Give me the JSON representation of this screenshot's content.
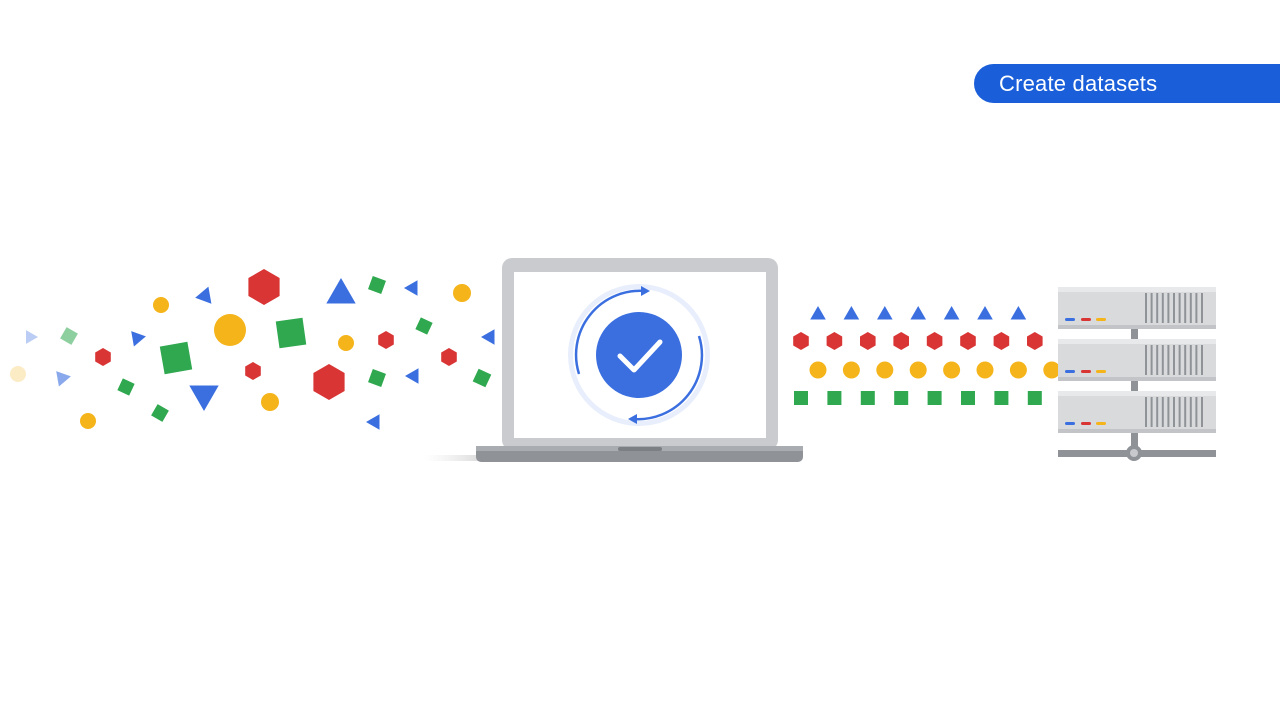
{
  "header": {
    "title": "Create datasets"
  },
  "colors": {
    "blue": "#3b6fe0",
    "red": "#d93535",
    "yellow": "#f4b41a",
    "green": "#2fa84f",
    "laptop_gray": "#c7c9cc",
    "server_gray": "#d9dadc"
  },
  "icons": {
    "center": "check-circle-icon",
    "cycle": "refresh-cycle-icon",
    "device": "laptop-icon",
    "storage": "server-rack-icon"
  }
}
